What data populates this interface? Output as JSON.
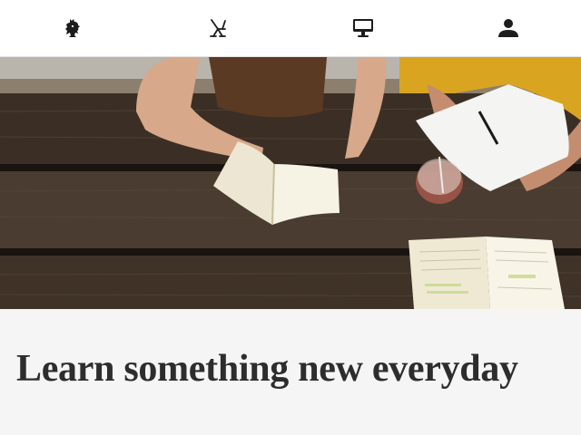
{
  "nav": {
    "items": [
      {
        "icon": "lion-crest-icon"
      },
      {
        "icon": "chair-icon"
      },
      {
        "icon": "monitor-icon"
      },
      {
        "icon": "user-icon"
      }
    ]
  },
  "hero": {
    "image": "students-reading-at-picnic-table-photo"
  },
  "content": {
    "headline": "Learn something new everyday"
  }
}
